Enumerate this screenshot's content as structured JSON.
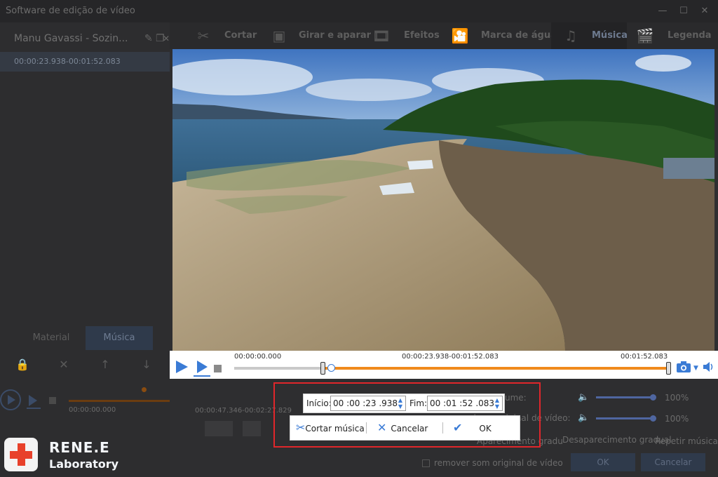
{
  "window": {
    "title": "Software de edição de vídeo"
  },
  "left_panel": {
    "project_title": "Manu Gavassi - Sozin...",
    "clip_time": "00:00:23.938-00:01:52.083",
    "tabs": [
      {
        "label": "Material"
      },
      {
        "label": "Música"
      }
    ],
    "timeline": {
      "start": "00:00:00.000",
      "range": "00:00:47.346-00:02:27.829"
    }
  },
  "toolbar": {
    "items": [
      {
        "label": "Cortar",
        "icon": "cut-icon"
      },
      {
        "label": "Girar e aparar",
        "icon": "crop-icon"
      },
      {
        "label": "Efeitos",
        "icon": "effects-icon"
      },
      {
        "label": "Marca de água",
        "icon": "watermark-icon"
      },
      {
        "label": "Música",
        "icon": "music-icon",
        "active": true
      },
      {
        "label": "Legenda",
        "icon": "subtitle-icon"
      }
    ]
  },
  "player": {
    "time_start": "00:00:00.000",
    "time_range": "00:00:23.938-00:01:52.083",
    "time_end": "00:01:52.083"
  },
  "music_settings": {
    "volume_label": "ume:",
    "volume_value": "100%",
    "original_volume_label": "volume original de vídeo:",
    "original_volume_value": "100%",
    "fade_in_label": "Aparecimento gradu",
    "fade_out_label": "Desaparecimento gradual",
    "repeat_label": "Repetir música",
    "remove_original_label": "remover som original de vídeo",
    "ok_label": "OK",
    "cancel_label": "Cancelar"
  },
  "popup": {
    "start_label": "Início:",
    "start_value": "00 :00 :23 .938",
    "end_label": "Fim:",
    "end_value": "00 :01 :52 .083",
    "cut_label": "Cortar música",
    "cancel_label": "Cancelar",
    "ok_label": "OK"
  },
  "logo": {
    "name": "RENE.E",
    "sub": "Laboratory"
  }
}
